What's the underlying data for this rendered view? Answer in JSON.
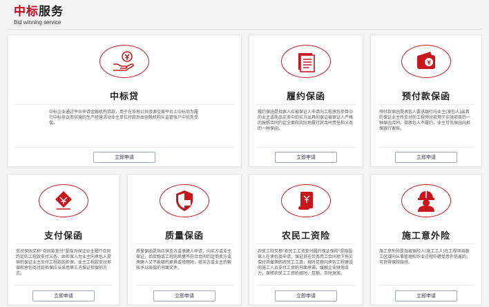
{
  "header": {
    "title_accent": "中标",
    "title_rest": "服务",
    "subtitle": "Bid winning service"
  },
  "colors": {
    "accent": "#c8161d",
    "title": "#d0021b"
  },
  "cards": [
    {
      "title": "中标贷",
      "icon": "hand-money-icon",
      "desc": "中标企业通过平台申请金融机构贷款，用于在各地公共资源交易平台上中标后为履行中标协议而实施的生产经营活动业主单位付款后由金融机构从监管账户中优先受偿。",
      "button": "立即申请"
    },
    {
      "title": "履约保函",
      "icon": "document-stack-icon",
      "desc": "履约保函是指保人应被保证人申请向工程承包项目中的业主或商品买卖中的买方出具的保证被保证人严格的按照合同约定全面和实际地履行其合同责任和义务的一种保函。",
      "button": "立即申请"
    },
    {
      "title": "预付款保函",
      "icon": "wallet-icon",
      "desc": "预付款保函是承包人要求银行向业主(发包人)出具的保证业主所支付的工程预付款用于实施项目的一种保函合同。如承包人不履约，业主可凭保函向担保银行索赔。",
      "button": "立即申请"
    },
    {
      "title": "支付保函",
      "icon": "payment-stamp-icon",
      "desc": "支付保函又称\"合同款支付\"是指为保证业主履行合同约定的工程款支付义务。由担保人为业主向承包人提供的保证业主支付工程款的担保。业主工程款支付担保和承包商付款担保应当采用第三方保证担保的方式。",
      "button": "立即申请"
    },
    {
      "title": "质量保函",
      "icon": "shield-icon",
      "desc": "质量保函是指应供货方或承建人申请，向买方或业主保证，如货物或工程的质量不符合合同约定而卖方或承建人又不能够的更换或修理时，按买方或业主的索赔予以赔偿的书面文件。",
      "button": "立即申请"
    },
    {
      "title": "农民工资险",
      "icon": "scroll-icon",
      "desc": "农民工险又称\"农民工工资支付履约保证保险\"是指投保人在承包商申请，保证其在劳务用工合同项下拖欠偿付其雇佣的农民工工资，按时足额向承包工程建设的施工人员支付工资的书面承诺，缓解企业财务压力，保障农民工工资的按时、足额、及时发放。",
      "button": "立即申请"
    },
    {
      "title": "施工意外险",
      "icon": "construction-worker-icon",
      "desc": "施工意外险是指被保险人(施工工人)在工程项目施工区域内从事管理和作业过程中遭受意外伤害的，可获得保险赔付。",
      "button": "立即申请"
    }
  ]
}
